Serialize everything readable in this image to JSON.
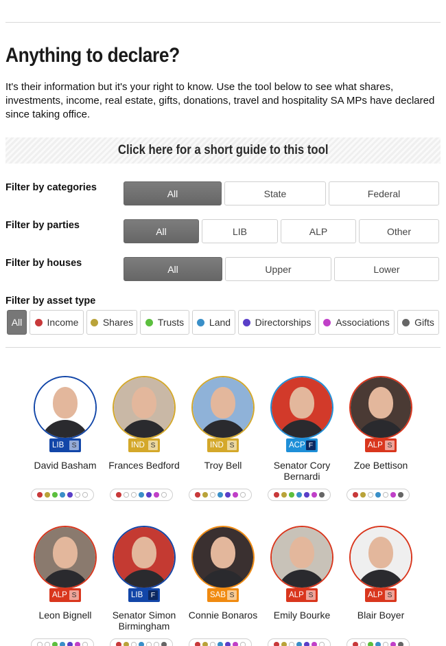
{
  "header": {
    "title": "Anything to declare?",
    "intro": "It's their information but it's your right to know. Use the tool below to see what shares, investments, income, real estate, gifts, donations, travel and hospitality SA MPs have declared since taking office.",
    "guide_label": "Click here for a short guide to this tool"
  },
  "filters": {
    "categories": {
      "label": "Filter by categories",
      "options": [
        "All",
        "State",
        "Federal"
      ],
      "selected": "All"
    },
    "parties": {
      "label": "Filter by parties",
      "options": [
        "All",
        "LIB",
        "ALP",
        "Other"
      ],
      "selected": "All"
    },
    "houses": {
      "label": "Filter by houses",
      "options": [
        "All",
        "Upper",
        "Lower"
      ],
      "selected": "All"
    },
    "asset_type": {
      "label": "Filter by asset type",
      "options": [
        {
          "label": "All",
          "color": null
        },
        {
          "label": "Income",
          "color": "#c8393a"
        },
        {
          "label": "Shares",
          "color": "#b9a33a"
        },
        {
          "label": "Trusts",
          "color": "#5cbf3e"
        },
        {
          "label": "Land",
          "color": "#3a8fc8"
        },
        {
          "label": "Directorships",
          "color": "#5a3fc8"
        },
        {
          "label": "Associations",
          "color": "#c040c8"
        },
        {
          "label": "Gifts",
          "color": "#666666"
        }
      ],
      "selected": "All"
    }
  },
  "members": [
    {
      "name": "David Basham",
      "party": "LIB",
      "house": "S",
      "party_color": "#1246a8",
      "bg": "#ffffff",
      "dots": [
        1,
        1,
        1,
        1,
        1,
        0,
        0
      ]
    },
    {
      "name": "Frances Bedford",
      "party": "IND",
      "house": "S",
      "party_color": "#d4a82a",
      "bg": "#c9b8a6",
      "dots": [
        1,
        0,
        0,
        1,
        1,
        1,
        0
      ]
    },
    {
      "name": "Troy Bell",
      "party": "IND",
      "house": "S",
      "party_color": "#d4a82a",
      "bg": "#8fb2d8",
      "dots": [
        1,
        1,
        0,
        1,
        1,
        1,
        0
      ]
    },
    {
      "name": "Senator Cory Bernardi",
      "party": "ACP",
      "house": "F",
      "party_color": "#1e8fd8",
      "bg": "#d23a2a",
      "dots": [
        1,
        1,
        1,
        1,
        1,
        1,
        1
      ]
    },
    {
      "name": "Zoe Bettison",
      "party": "ALP",
      "house": "S",
      "party_color": "#d9361d",
      "bg": "#4a3a34",
      "dots": [
        1,
        1,
        0,
        1,
        0,
        1,
        1
      ]
    },
    {
      "name": "Leon Bignell",
      "party": "ALP",
      "house": "S",
      "party_color": "#d9361d",
      "bg": "#8a7a6e",
      "dots": [
        0,
        0,
        1,
        1,
        1,
        1,
        0
      ]
    },
    {
      "name": "Senator Simon Birmingham",
      "party": "LIB",
      "house": "F",
      "party_color": "#1246a8",
      "bg": "#c43a32",
      "dots": [
        1,
        1,
        0,
        1,
        0,
        0,
        1
      ]
    },
    {
      "name": "Connie Bonaros",
      "party": "SAB",
      "house": "S",
      "party_color": "#f08a10",
      "bg": "#3a3030",
      "dots": [
        1,
        1,
        0,
        1,
        1,
        1,
        0
      ]
    },
    {
      "name": "Emily Bourke",
      "party": "ALP",
      "house": "S",
      "party_color": "#d9361d",
      "bg": "#c8c2b8",
      "dots": [
        1,
        1,
        0,
        1,
        1,
        1,
        0
      ]
    },
    {
      "name": "Blair Boyer",
      "party": "ALP",
      "house": "S",
      "party_color": "#d9361d",
      "bg": "#efefef",
      "dots": [
        1,
        0,
        1,
        1,
        0,
        1,
        1
      ]
    }
  ]
}
